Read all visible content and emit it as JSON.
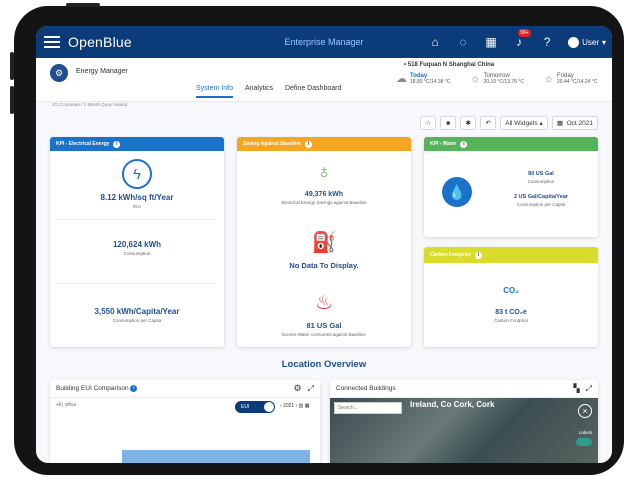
{
  "header": {
    "logo": "OpenBlue",
    "app_title": "Enterprise Manager",
    "notif_badge": "99+",
    "user_label": "User"
  },
  "subheader": {
    "title": "Energy Manager",
    "tabs": [
      "System Info",
      "Analytics",
      "Define Dashboard"
    ],
    "active_tab": 0,
    "location": "518 Fuquan N Shanghai China",
    "weather": [
      {
        "day": "Today",
        "temp": "18.80 °C/14.38 °C"
      },
      {
        "day": "Tomorrow",
        "temp": "20.10 °C/13.76 °C"
      },
      {
        "day": "Friday",
        "temp": "20.44 °C/14.24 °C"
      }
    ],
    "breadcrumb": "JCI Corporate  /  1 Marsh Quay Ireland"
  },
  "toolbar": {
    "widgets": "All Widgets",
    "month": "Oct 2021"
  },
  "kpi_electrical": {
    "title": "KPI - Electrical Energy",
    "eui_value": "8.12 kWh/sq ft/Year",
    "eui_label": "EUI",
    "consumption_value": "120,624 kWh",
    "consumption_label": "Consumption",
    "capita_value": "3,550 kWh/Capita/Year",
    "capita_label": "Consumption per Capita"
  },
  "saving_baseline": {
    "title": "Saving Against Baseline",
    "energy_value": "49,376 kWh",
    "energy_label": "Electrical Energy Savings against Baseline",
    "mid_value": "No Data To Display.",
    "water_value": "81 US Gal",
    "water_label": "Excess Water consumed against Baseline"
  },
  "kpi_water": {
    "title": "KPI - Water",
    "consumption_value": "80 US Gal",
    "consumption_label": "Consumption",
    "capita_value": "2 US Gal/Capita/Year",
    "capita_label": "Consumption per Capita"
  },
  "carbon": {
    "title": "Carbon Footprint",
    "co2_icon_label": "CO₂",
    "value": "83 t CO₂e",
    "label": "Carbon Footprint"
  },
  "location_overview": "Location Overview",
  "eui_comparison": {
    "title": "Building EUI Comparison",
    "filter_all": "All",
    "filter_office": "Office",
    "toggle_label": "EUI",
    "year": "2021"
  },
  "connected_buildings": {
    "title": "Connected Buildings",
    "search_placeholder": "Search...",
    "map_label": "Ireland, Co Cork, Cork",
    "labels_toggle": "Labels"
  },
  "colors": {
    "nav": "#0c3b7a",
    "electrical": "#1a73c9",
    "saving": "#f5a623",
    "water": "#57b35a",
    "carbon": "#d9dc2c"
  }
}
